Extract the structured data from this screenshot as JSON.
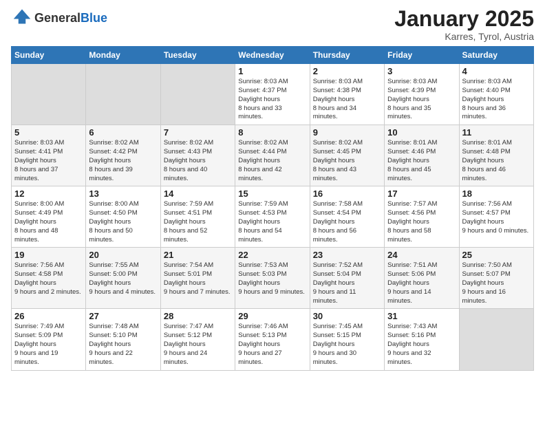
{
  "logo": {
    "general": "General",
    "blue": "Blue"
  },
  "header": {
    "month": "January 2025",
    "location": "Karres, Tyrol, Austria"
  },
  "weekdays": [
    "Sunday",
    "Monday",
    "Tuesday",
    "Wednesday",
    "Thursday",
    "Friday",
    "Saturday"
  ],
  "weeks": [
    [
      {
        "day": "",
        "empty": true
      },
      {
        "day": "",
        "empty": true
      },
      {
        "day": "",
        "empty": true
      },
      {
        "day": "1",
        "sunrise": "8:03 AM",
        "sunset": "4:37 PM",
        "daylight": "8 hours and 33 minutes."
      },
      {
        "day": "2",
        "sunrise": "8:03 AM",
        "sunset": "4:38 PM",
        "daylight": "8 hours and 34 minutes."
      },
      {
        "day": "3",
        "sunrise": "8:03 AM",
        "sunset": "4:39 PM",
        "daylight": "8 hours and 35 minutes."
      },
      {
        "day": "4",
        "sunrise": "8:03 AM",
        "sunset": "4:40 PM",
        "daylight": "8 hours and 36 minutes."
      }
    ],
    [
      {
        "day": "5",
        "sunrise": "8:03 AM",
        "sunset": "4:41 PM",
        "daylight": "8 hours and 37 minutes."
      },
      {
        "day": "6",
        "sunrise": "8:02 AM",
        "sunset": "4:42 PM",
        "daylight": "8 hours and 39 minutes."
      },
      {
        "day": "7",
        "sunrise": "8:02 AM",
        "sunset": "4:43 PM",
        "daylight": "8 hours and 40 minutes."
      },
      {
        "day": "8",
        "sunrise": "8:02 AM",
        "sunset": "4:44 PM",
        "daylight": "8 hours and 42 minutes."
      },
      {
        "day": "9",
        "sunrise": "8:02 AM",
        "sunset": "4:45 PM",
        "daylight": "8 hours and 43 minutes."
      },
      {
        "day": "10",
        "sunrise": "8:01 AM",
        "sunset": "4:46 PM",
        "daylight": "8 hours and 45 minutes."
      },
      {
        "day": "11",
        "sunrise": "8:01 AM",
        "sunset": "4:48 PM",
        "daylight": "8 hours and 46 minutes."
      }
    ],
    [
      {
        "day": "12",
        "sunrise": "8:00 AM",
        "sunset": "4:49 PM",
        "daylight": "8 hours and 48 minutes."
      },
      {
        "day": "13",
        "sunrise": "8:00 AM",
        "sunset": "4:50 PM",
        "daylight": "8 hours and 50 minutes."
      },
      {
        "day": "14",
        "sunrise": "7:59 AM",
        "sunset": "4:51 PM",
        "daylight": "8 hours and 52 minutes."
      },
      {
        "day": "15",
        "sunrise": "7:59 AM",
        "sunset": "4:53 PM",
        "daylight": "8 hours and 54 minutes."
      },
      {
        "day": "16",
        "sunrise": "7:58 AM",
        "sunset": "4:54 PM",
        "daylight": "8 hours and 56 minutes."
      },
      {
        "day": "17",
        "sunrise": "7:57 AM",
        "sunset": "4:56 PM",
        "daylight": "8 hours and 58 minutes."
      },
      {
        "day": "18",
        "sunrise": "7:56 AM",
        "sunset": "4:57 PM",
        "daylight": "9 hours and 0 minutes."
      }
    ],
    [
      {
        "day": "19",
        "sunrise": "7:56 AM",
        "sunset": "4:58 PM",
        "daylight": "9 hours and 2 minutes."
      },
      {
        "day": "20",
        "sunrise": "7:55 AM",
        "sunset": "5:00 PM",
        "daylight": "9 hours and 4 minutes."
      },
      {
        "day": "21",
        "sunrise": "7:54 AM",
        "sunset": "5:01 PM",
        "daylight": "9 hours and 7 minutes."
      },
      {
        "day": "22",
        "sunrise": "7:53 AM",
        "sunset": "5:03 PM",
        "daylight": "9 hours and 9 minutes."
      },
      {
        "day": "23",
        "sunrise": "7:52 AM",
        "sunset": "5:04 PM",
        "daylight": "9 hours and 11 minutes."
      },
      {
        "day": "24",
        "sunrise": "7:51 AM",
        "sunset": "5:06 PM",
        "daylight": "9 hours and 14 minutes."
      },
      {
        "day": "25",
        "sunrise": "7:50 AM",
        "sunset": "5:07 PM",
        "daylight": "9 hours and 16 minutes."
      }
    ],
    [
      {
        "day": "26",
        "sunrise": "7:49 AM",
        "sunset": "5:09 PM",
        "daylight": "9 hours and 19 minutes."
      },
      {
        "day": "27",
        "sunrise": "7:48 AM",
        "sunset": "5:10 PM",
        "daylight": "9 hours and 22 minutes."
      },
      {
        "day": "28",
        "sunrise": "7:47 AM",
        "sunset": "5:12 PM",
        "daylight": "9 hours and 24 minutes."
      },
      {
        "day": "29",
        "sunrise": "7:46 AM",
        "sunset": "5:13 PM",
        "daylight": "9 hours and 27 minutes."
      },
      {
        "day": "30",
        "sunrise": "7:45 AM",
        "sunset": "5:15 PM",
        "daylight": "9 hours and 30 minutes."
      },
      {
        "day": "31",
        "sunrise": "7:43 AM",
        "sunset": "5:16 PM",
        "daylight": "9 hours and 32 minutes."
      },
      {
        "day": "",
        "empty": true
      }
    ]
  ],
  "labels": {
    "sunrise": "Sunrise:",
    "sunset": "Sunset:",
    "daylight": "Daylight hours"
  }
}
